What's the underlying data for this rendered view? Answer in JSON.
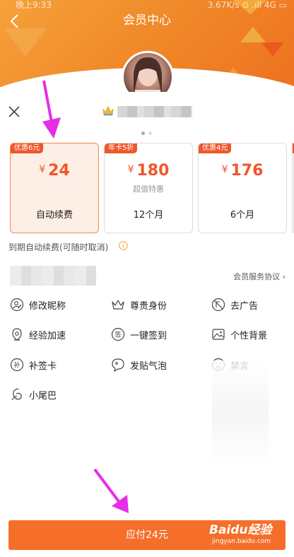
{
  "status_bar": {
    "time": "晚上9:33",
    "network": "3.67K/s",
    "icons": "⊙ .ıll 4G ▭"
  },
  "header": {
    "title": "会员中心"
  },
  "plans": [
    {
      "badge": "优惠6元",
      "currency": "¥",
      "price": "24",
      "note": "",
      "name": "自动续费",
      "selected": true
    },
    {
      "badge": "年卡5折",
      "currency": "¥",
      "price": "180",
      "note": "超值特惠",
      "name": "12个月",
      "selected": false
    },
    {
      "badge": "优惠4元",
      "currency": "¥",
      "price": "176",
      "note": "",
      "name": "6个月",
      "selected": false
    }
  ],
  "renewal_note": "到期自动续费(可随时取消)",
  "agreement_link": "会员服务协议 ›",
  "privileges": [
    {
      "label": "修改昵称",
      "icon": "edit-nickname-icon"
    },
    {
      "label": "尊贵身份",
      "icon": "crown-icon"
    },
    {
      "label": "去广告",
      "icon": "no-ads-icon"
    },
    {
      "label": "经验加速",
      "icon": "speed-icon"
    },
    {
      "label": "一键签到",
      "icon": "sign-in-icon"
    },
    {
      "label": "个性背景",
      "icon": "image-icon"
    },
    {
      "label": "补签卡",
      "icon": "resign-card-icon"
    },
    {
      "label": "发贴气泡",
      "icon": "bubble-icon"
    },
    {
      "label": "禁言",
      "icon": "mute-icon"
    },
    {
      "label": "小尾巴",
      "icon": "tail-icon"
    }
  ],
  "pay_button": "应付24元",
  "watermark": {
    "logo": "Baidu经验",
    "url": "jingyan.baidu.com"
  },
  "colors": {
    "accent": "#f56f2b",
    "badge": "#f1562b",
    "arrow": "#e62ee6"
  }
}
